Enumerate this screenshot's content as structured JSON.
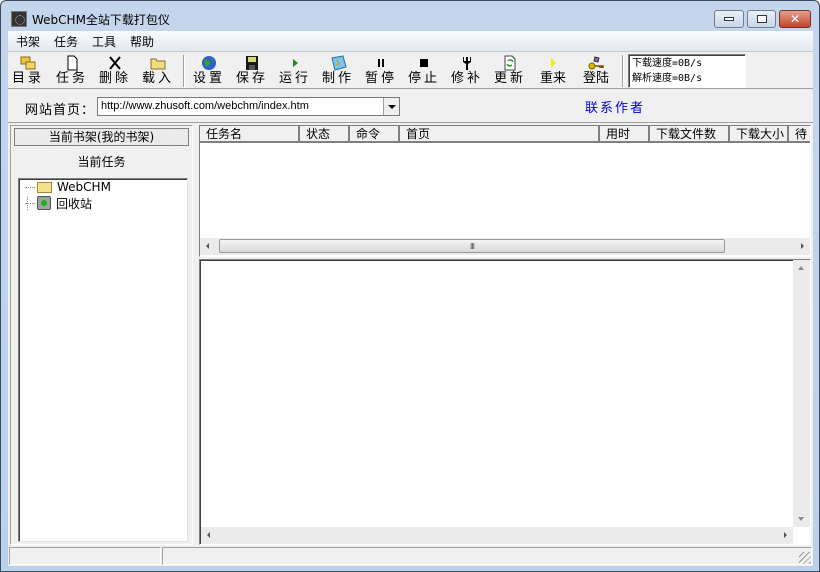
{
  "window": {
    "title": "WebCHM全站下载打包仪",
    "controls": {
      "minimize": "minimize",
      "maximize": "maximize",
      "close": "✕"
    }
  },
  "menu": [
    "书架",
    "任务",
    "工具",
    "帮助"
  ],
  "toolbar": {
    "buttons": [
      {
        "label": "目录",
        "icon": "folders-icon"
      },
      {
        "label": "任务",
        "icon": "new-document-icon"
      },
      {
        "label": "删除",
        "icon": "delete-x-icon"
      },
      {
        "label": "载入",
        "icon": "open-folder-icon"
      },
      {
        "label": "设置",
        "icon": "globe-icon"
      },
      {
        "label": "保存",
        "icon": "floppy-disk-icon"
      },
      {
        "label": "运行",
        "icon": "play-icon"
      },
      {
        "label": "制作",
        "icon": "compile-icon"
      },
      {
        "label": "暂停",
        "icon": "pause-icon"
      },
      {
        "label": "停止",
        "icon": "stop-icon"
      },
      {
        "label": "修补",
        "icon": "wrench-icon"
      },
      {
        "label": "更新",
        "icon": "refresh-icon"
      },
      {
        "label": "重来",
        "icon": "restart-arrow-icon"
      },
      {
        "label": "登陆",
        "icon": "key-login-icon"
      }
    ],
    "speed": {
      "download": "下载速度=0B/s",
      "parse": "解析速度=0B/s"
    }
  },
  "address": {
    "label": "网站首页：",
    "value": "http://www.zhusoft.com/webchm/index.htm",
    "contact_link": "联系作者"
  },
  "left_panel": {
    "shelf_button": "当前书架(我的书架)",
    "current_task_label": "当前任务",
    "tree": [
      {
        "label": "WebCHM",
        "icon": "folder-icon"
      },
      {
        "label": "回收站",
        "icon": "recycle-bin-icon"
      }
    ]
  },
  "task_table": {
    "columns": [
      "任务名",
      "状态",
      "命令",
      "首页",
      "用时",
      "下载文件数",
      "下载大小",
      "待"
    ],
    "rows": []
  },
  "status_bar": {
    "left": "",
    "right": ""
  }
}
